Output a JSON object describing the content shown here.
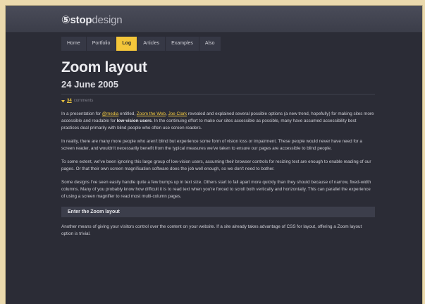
{
  "site": {
    "logo_glyph": "⑤",
    "logo_bold": "stop",
    "logo_light": "design"
  },
  "nav": {
    "items": [
      {
        "label": "Home",
        "active": false
      },
      {
        "label": "Portfolio",
        "active": false
      },
      {
        "label": "Log",
        "active": true
      },
      {
        "label": "Articles",
        "active": false
      },
      {
        "label": "Examples",
        "active": false
      },
      {
        "label": "Also",
        "active": false
      }
    ]
  },
  "post": {
    "title": "Zoom layout",
    "date": "24 June 2005",
    "comments_count": "34",
    "comments_word": "comments",
    "p1": {
      "t1": "In a presentation for ",
      "link1": "@media",
      "t2": " entitled, ",
      "link2": "Zoom the Web",
      "t3": ", ",
      "link3": "Joe Clark",
      "t4": " revealed and explained several possible options (a new trend, hopefully) for making sites more accessible and readable for ",
      "bold": "low-vision users",
      "t5": ". In the continuing effort to make our sites accessible as possible, many have assumed accessibility best practices deal primarily with blind people who often use screen readers."
    },
    "p2": "In reality, there are many more people who aren't blind but experience some form of vision loss or impairment. These people would never have need for a screen reader, and wouldn't necessarily benefit from the typical measures we've taken to ensure our pages are accessible to blind people.",
    "p3": "To some extent, we've been ignoring this large group of low-vision users, assuming their browser controls for resizing text are enough to enable reading of our pages. Or that their own screen magnification software does the job well enough, so we don't need to bother.",
    "p4": "Some designs I've seen easily handle quite a few bumps up in text size. Others start to fall apart more quickly than they should because of narrow, fixed-width columns. Many of you probably know how difficult it is to read text when you're forced to scroll both vertically and horizontally. This can parallel the experience of using a screen magnifier to read most multi-column pages.",
    "section_heading": "Enter the Zoom layout",
    "p5": "Another means of giving your visitors control over the content on your website. If a site already takes advantage of CSS for layout, offering a Zoom layout option is trivial."
  }
}
